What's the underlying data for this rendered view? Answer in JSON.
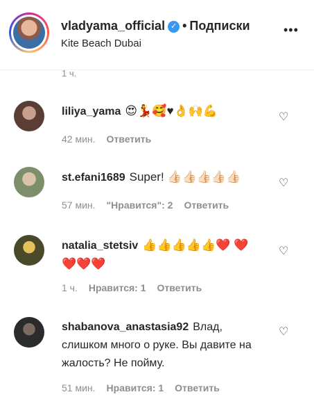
{
  "post_header": {
    "username": "vladyama_official",
    "dot": "•",
    "follow_label": "Подписки",
    "location": "Kite Beach Dubai",
    "more_icon": "more-dots-icon"
  },
  "top_time": "1 ч.",
  "comments": [
    {
      "username": "liliya_yama",
      "text": "😍💃🥰♥👌🙌💪",
      "time": "42 мин.",
      "likes": "",
      "reply_label": "Ответить"
    },
    {
      "username": "st.efani1689",
      "text": "Super! 👍🏻👍🏻👍🏻👍🏻👍🏻",
      "time": "57 мин.",
      "likes": "\"Нравится\": 2",
      "reply_label": "Ответить"
    },
    {
      "username": "natalia_stetsiv",
      "text": "👍👍👍👍👍❤️ ❤️❤️❤️❤️",
      "time": "1 ч.",
      "likes": "Нравится: 1",
      "reply_label": "Ответить"
    },
    {
      "username": "shabanova_anastasia92",
      "text": "Влад, слишком много о руке. Вы давите на жалость? Не пойму.",
      "time": "51 мин.",
      "likes": "Нравится: 1",
      "reply_label": "Ответить"
    }
  ],
  "like_icon": "heart-outline-icon"
}
